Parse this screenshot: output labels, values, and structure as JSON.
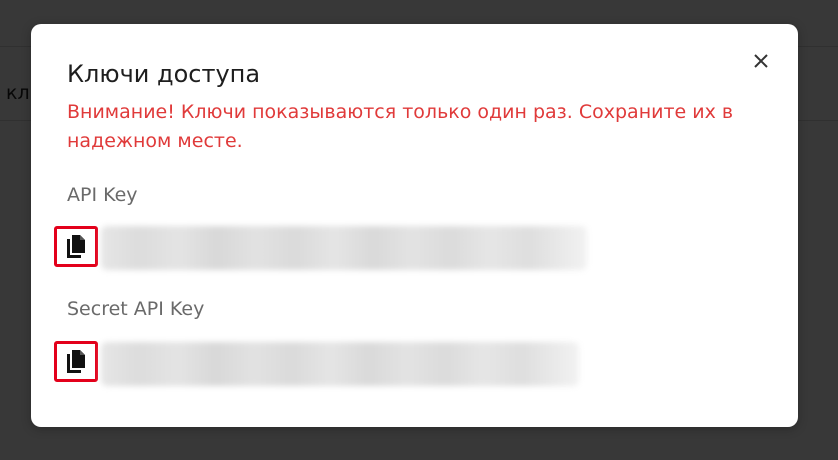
{
  "background": {
    "row_text": "кл"
  },
  "modal": {
    "title": "Ключи доступа",
    "warning": "Внимание! Ключи показываются только один раз. Сохраните их в надежном месте.",
    "close_icon": "close-icon",
    "fields": [
      {
        "label": "API Key",
        "copy_icon": "copy-icon",
        "value_state": "blurred"
      },
      {
        "label": "Secret API Key",
        "copy_icon": "copy-icon",
        "value_state": "blurred"
      }
    ]
  },
  "colors": {
    "warning": "#e03a3a",
    "highlight_border": "#e3001b",
    "overlay": "rgba(0,0,0,0.78)"
  }
}
